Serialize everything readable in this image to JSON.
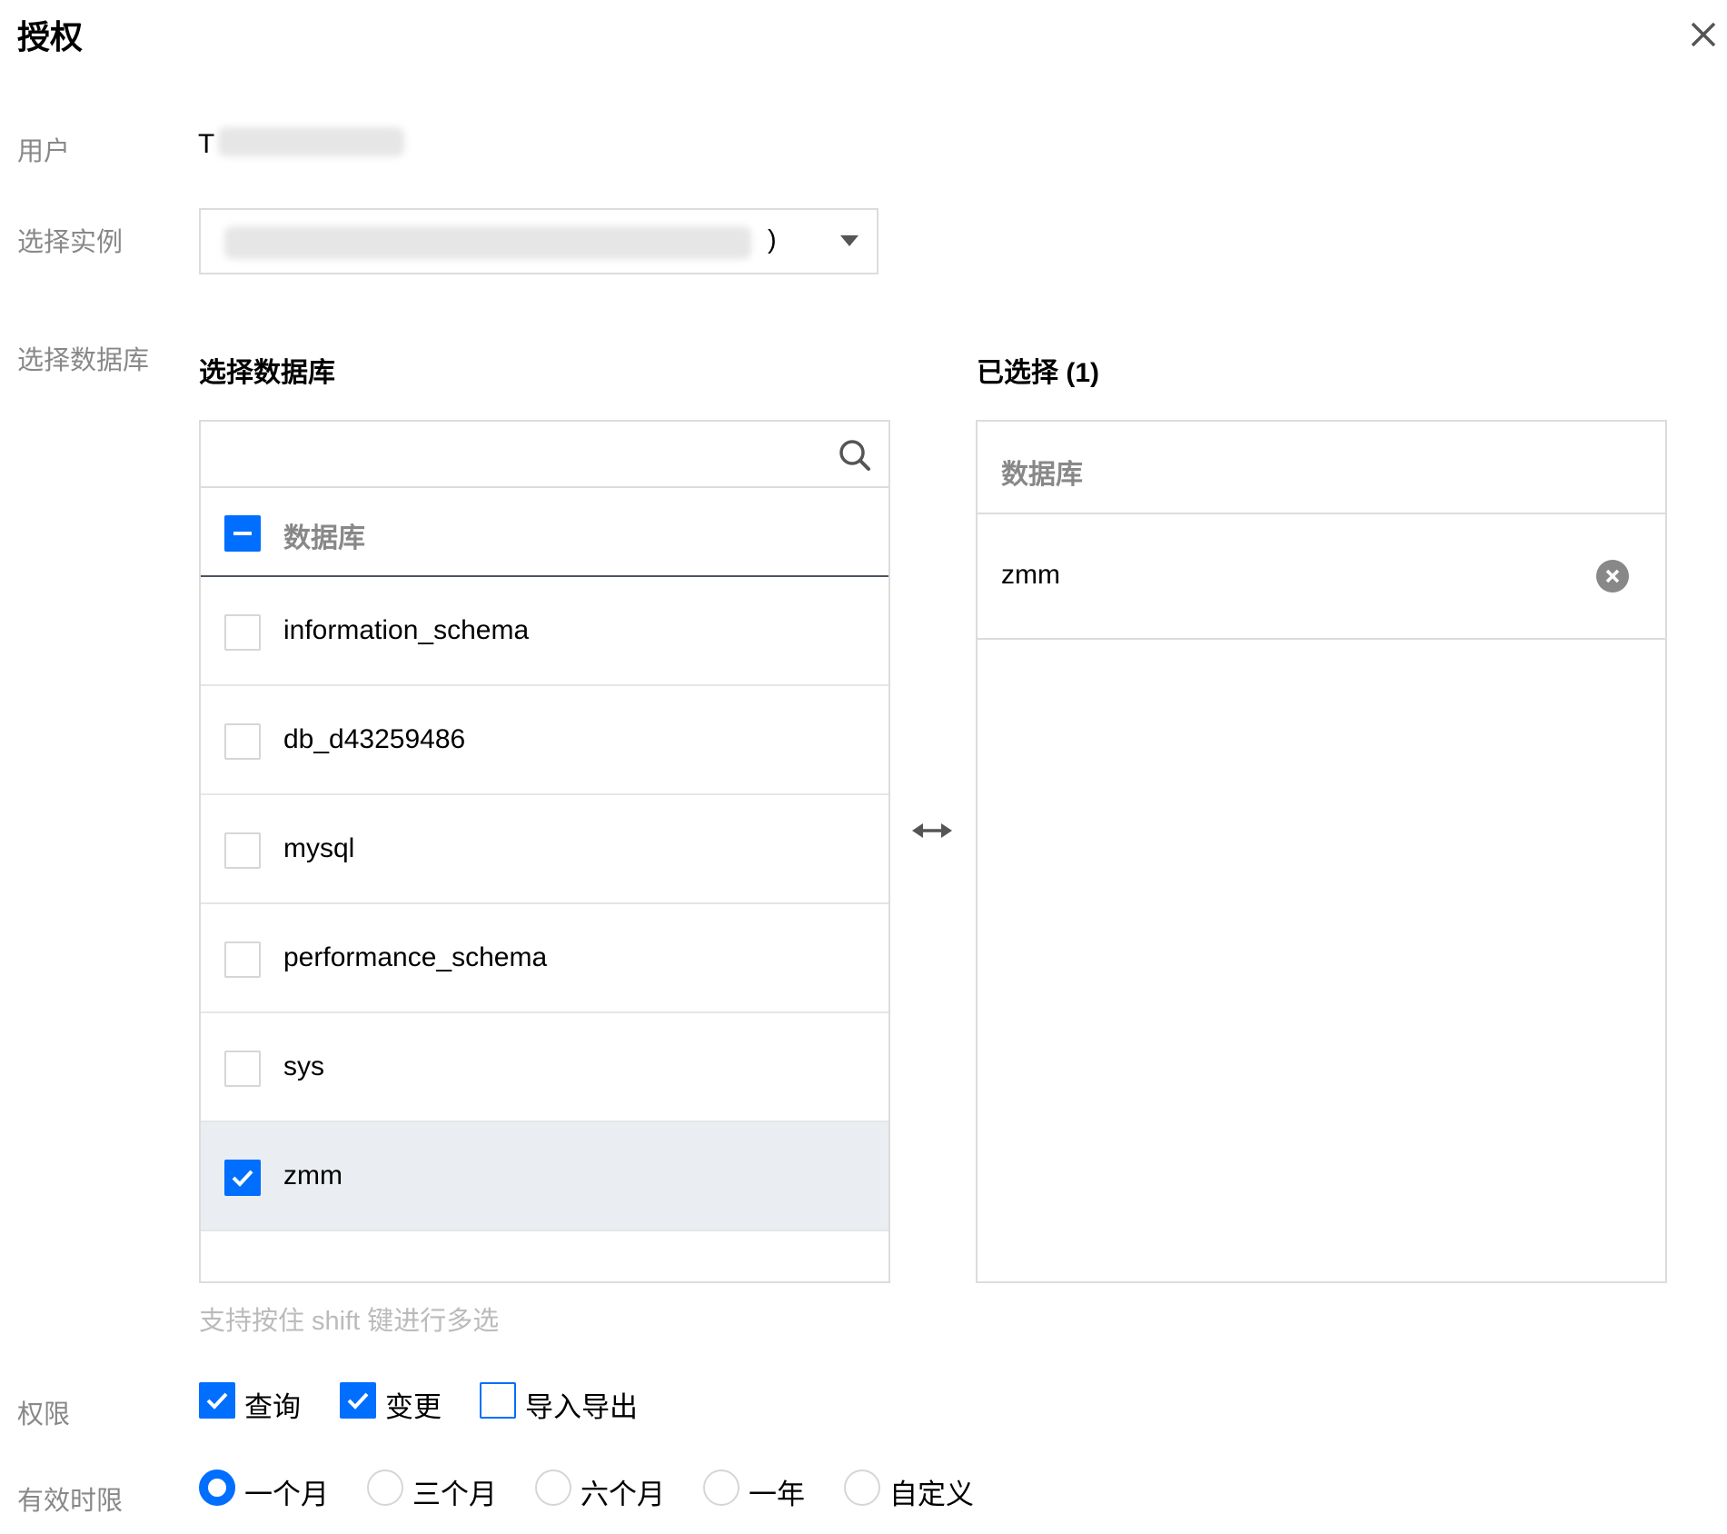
{
  "dialog": {
    "title": "授权",
    "close_icon": "close-icon"
  },
  "form": {
    "user_label": "用户",
    "user_value": "T",
    "instance_label": "选择实例",
    "instance_value": ")",
    "database_label": "选择数据库",
    "permission_label": "权限",
    "validity_label": "有效时限"
  },
  "transfer": {
    "source_title": "选择数据库",
    "target_title": "已选择 (1)",
    "search_placeholder": "",
    "source_header": "数据库",
    "source_items": [
      {
        "label": "information_schema",
        "checked": false
      },
      {
        "label": "db_d43259486",
        "checked": false
      },
      {
        "label": "mysql",
        "checked": false
      },
      {
        "label": "performance_schema",
        "checked": false
      },
      {
        "label": "sys",
        "checked": false
      },
      {
        "label": "zmm",
        "checked": true
      }
    ],
    "target_header": "数据库",
    "target_items": [
      {
        "label": "zmm"
      }
    ],
    "hint": "支持按住 shift 键进行多选"
  },
  "permissions": [
    {
      "label": "查询",
      "checked": true
    },
    {
      "label": "变更",
      "checked": true
    },
    {
      "label": "导入导出",
      "checked": false
    }
  ],
  "validity": {
    "options": [
      "一个月",
      "三个月",
      "六个月",
      "一年",
      "自定义"
    ],
    "selected": "一个月"
  },
  "colors": {
    "accent": "#006eff",
    "label_gray": "#888888",
    "border": "#dcdcdc",
    "selected_row": "#eaedf2"
  }
}
